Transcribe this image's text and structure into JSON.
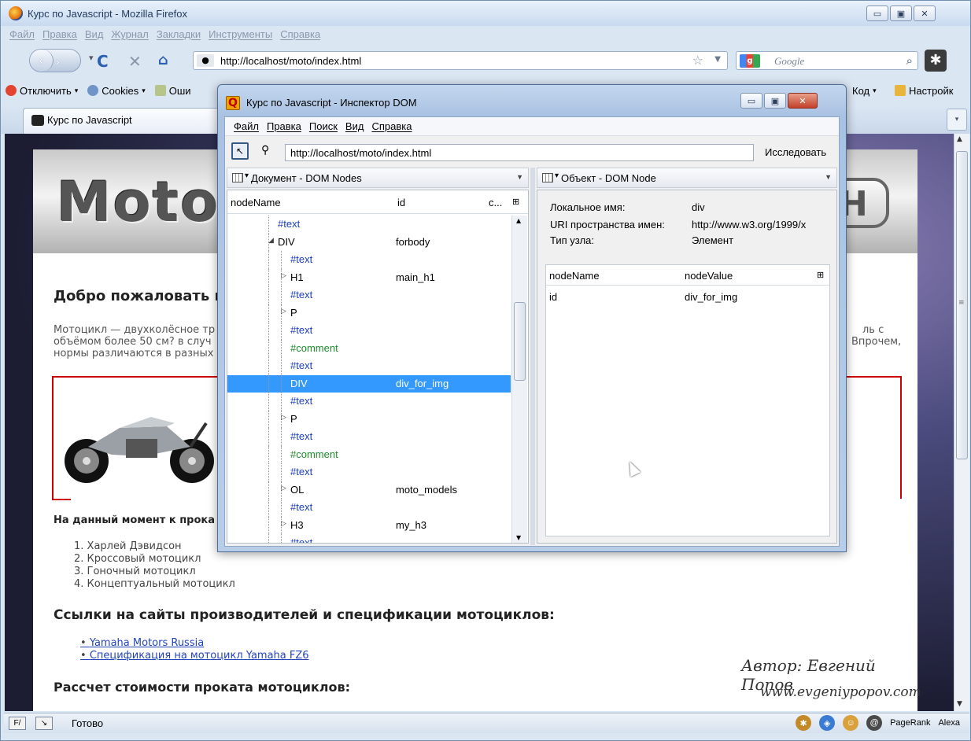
{
  "firefox": {
    "title": "Курс по Javascript - Mozilla Firefox",
    "window_buttons": [
      "▭",
      "▣",
      "✕"
    ],
    "menu": [
      "Файл",
      "Правка",
      "Вид",
      "Журнал",
      "Закладки",
      "Инструменты",
      "Справка"
    ],
    "url": "http://localhost/moto/index.html",
    "search_placeholder": "Google",
    "bookmarks": [
      "Отключить",
      "Cookies",
      "Оши",
      "Код",
      "Настройк"
    ],
    "tab_title": "Курс по Javascript",
    "status": "Готово",
    "status_right": [
      "PageRank",
      "Alexa"
    ]
  },
  "page": {
    "logo_text": "Moto",
    "welcome": "Добро пожаловать н",
    "intro_lines": [
      "Мотоцикл — двухколёсное тр",
      "объёмом более 50 см? в случ",
      "нормы различаются в разных"
    ],
    "intro_right_lines": [
      "ль с",
      "Впрочем,"
    ],
    "rental_heading": "На данный момент к прока",
    "models": [
      "1. Харлей Дэвидсон",
      "2. Кроссовый мотоцикл",
      "3. Гоночный мотоцикл",
      "4. Концептуальный мотоцикл"
    ],
    "links_heading": "Ссылки на сайты производителей и спецификации мотоциклов:",
    "links": [
      "Yamaha Motors Russia",
      "Спецификация на мотоцикл Yamaha FZ6"
    ],
    "price_heading": "Рассчет стоимости проката мотоциклов:",
    "author": "Автор: Евгений Попов",
    "author_site": "www.evgeniypopov.com"
  },
  "inspector": {
    "title": "Курс по Javascript - Инспектор DOM",
    "menu": [
      "Файл",
      "Правка",
      "Поиск",
      "Вид",
      "Справка"
    ],
    "url": "http://localhost/moto/index.html",
    "inspect_button": "Исследовать",
    "left_pane_title": "Документ - DOM Nodes",
    "right_pane_title": "Объект - DOM Node",
    "tree_columns": [
      "nodeName",
      "id",
      "c..."
    ],
    "tree_rows": [
      {
        "name": "#text",
        "id": "",
        "kind": "text"
      },
      {
        "name": "DIV",
        "id": "forbody",
        "kind": "element",
        "twisty": "◢"
      },
      {
        "name": "#text",
        "id": "",
        "kind": "text"
      },
      {
        "name": "H1",
        "id": "main_h1",
        "kind": "element",
        "twisty": "▷"
      },
      {
        "name": "#text",
        "id": "",
        "kind": "text"
      },
      {
        "name": "P",
        "id": "",
        "kind": "element",
        "twisty": "▷"
      },
      {
        "name": "#text",
        "id": "",
        "kind": "text"
      },
      {
        "name": "#comment",
        "id": "",
        "kind": "comment"
      },
      {
        "name": "#text",
        "id": "",
        "kind": "text"
      },
      {
        "name": "DIV",
        "id": "div_for_img",
        "kind": "selected"
      },
      {
        "name": "#text",
        "id": "",
        "kind": "text"
      },
      {
        "name": "P",
        "id": "",
        "kind": "element",
        "twisty": "▷"
      },
      {
        "name": "#text",
        "id": "",
        "kind": "text"
      },
      {
        "name": "#comment",
        "id": "",
        "kind": "comment"
      },
      {
        "name": "#text",
        "id": "",
        "kind": "text"
      },
      {
        "name": "OL",
        "id": "moto_models",
        "kind": "element",
        "twisty": "▷"
      },
      {
        "name": "#text",
        "id": "",
        "kind": "text"
      },
      {
        "name": "H3",
        "id": "my_h3",
        "kind": "element",
        "twisty": "▷"
      },
      {
        "name": "#text",
        "id": "",
        "kind": "text"
      }
    ],
    "node_props": [
      {
        "key": "Локальное имя:",
        "value": "div"
      },
      {
        "key": "URI пространства имен:",
        "value": "http://www.w3.org/1999/x"
      },
      {
        "key": "Тип узла:",
        "value": "Элемент"
      }
    ],
    "attr_columns": [
      "nodeName",
      "nodeValue"
    ],
    "attr_rows": [
      {
        "name": "id",
        "value": "div_for_img"
      }
    ]
  }
}
